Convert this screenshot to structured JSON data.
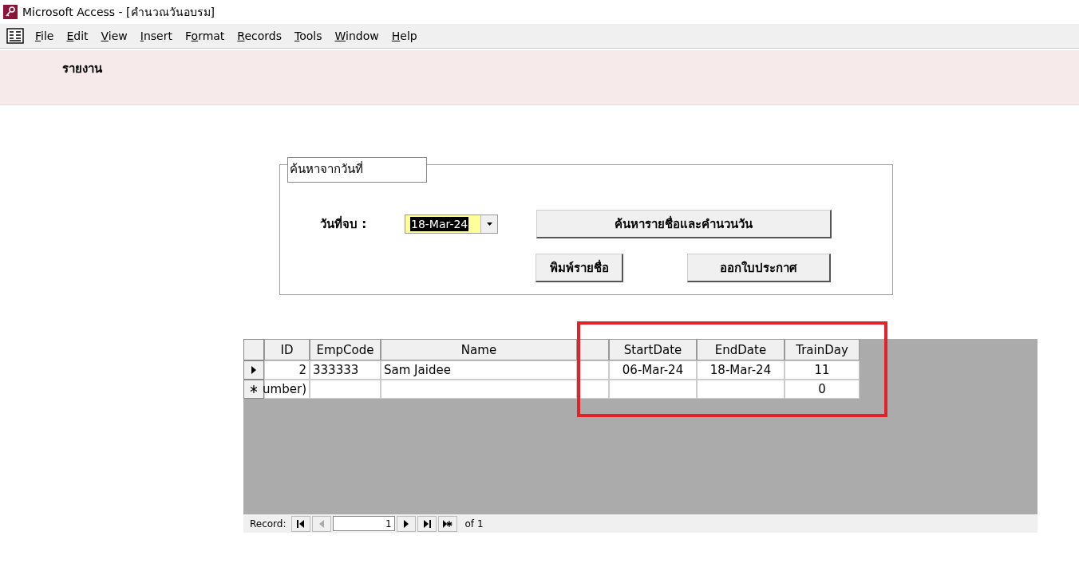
{
  "window": {
    "title": "Microsoft Access - [คำนวณวันอบรม]"
  },
  "menu": [
    {
      "label": "File"
    },
    {
      "label": "Edit"
    },
    {
      "label": "View"
    },
    {
      "label": "Insert"
    },
    {
      "label": "Format"
    },
    {
      "label": "Records"
    },
    {
      "label": "Tools"
    },
    {
      "label": "Window"
    },
    {
      "label": "Help"
    }
  ],
  "header": {
    "title": "รายงาน"
  },
  "search_frame": {
    "legend": "ค้นหาจากวันที่",
    "date_label": "วันที่จบ :",
    "date_value": "18-Mar-24",
    "buttons": [
      {
        "label": "ค้นหารายชื่อและคำนวนวัน"
      },
      {
        "label": "พิมพ์รายชื่อ"
      },
      {
        "label": "ออกใบประกาศ"
      }
    ]
  },
  "table": {
    "columns": [
      {
        "label": "ID"
      },
      {
        "label": "EmpCode"
      },
      {
        "label": "Name"
      },
      {},
      {
        "label": "StartDate"
      },
      {
        "label": "EndDate"
      },
      {
        "label": "TrainDay"
      }
    ],
    "rows": [
      {
        "kind": "current",
        "cells": [
          "2",
          "333333",
          "Sam Jaidee",
          "",
          "06-Mar-24",
          "18-Mar-24",
          "11"
        ]
      },
      {
        "kind": "new",
        "cells": [
          "umber)",
          "",
          "",
          "",
          "",
          "",
          "0"
        ]
      }
    ]
  },
  "record_nav": {
    "label": "Record:",
    "current": "1",
    "total": "of 1",
    "buttons": [
      {
        "kind": "first",
        "disabled": false
      },
      {
        "kind": "prev",
        "disabled": true
      },
      {
        "kind": "next",
        "disabled": false
      },
      {
        "kind": "last",
        "disabled": false
      },
      {
        "kind": "new",
        "disabled": false
      }
    ]
  }
}
